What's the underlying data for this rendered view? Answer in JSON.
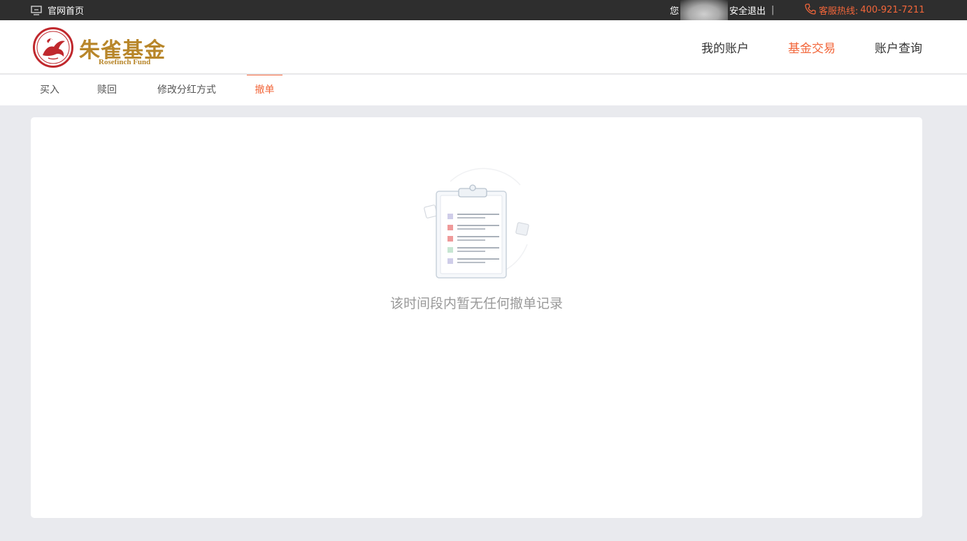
{
  "topbar": {
    "home_label": "官网首页",
    "greeting": "您",
    "logout_label": "安全退出",
    "separator": "|",
    "hotline_label": "客服热线:",
    "hotline_number": "400-921-7211"
  },
  "brand": {
    "name_cn": "朱雀基金",
    "name_en": "Rosefinch Fund",
    "color": "#b8862a",
    "seal_color": "#c0282d"
  },
  "main_nav": {
    "items": [
      {
        "label": "我的账户",
        "active": false
      },
      {
        "label": "基金交易",
        "active": true
      },
      {
        "label": "账户查询",
        "active": false
      }
    ]
  },
  "sub_nav": {
    "tabs": [
      {
        "label": "买入",
        "active": false
      },
      {
        "label": "赎回",
        "active": false
      },
      {
        "label": "修改分红方式",
        "active": false
      },
      {
        "label": "撤单",
        "active": true
      }
    ]
  },
  "content": {
    "empty_message": "该时间段内暂无任何撤单记录",
    "empty_icon": "clipboard-list-icon"
  },
  "colors": {
    "accent": "#f2663a",
    "topbar_bg": "#2e2e2e",
    "page_bg": "#e9eaee"
  }
}
